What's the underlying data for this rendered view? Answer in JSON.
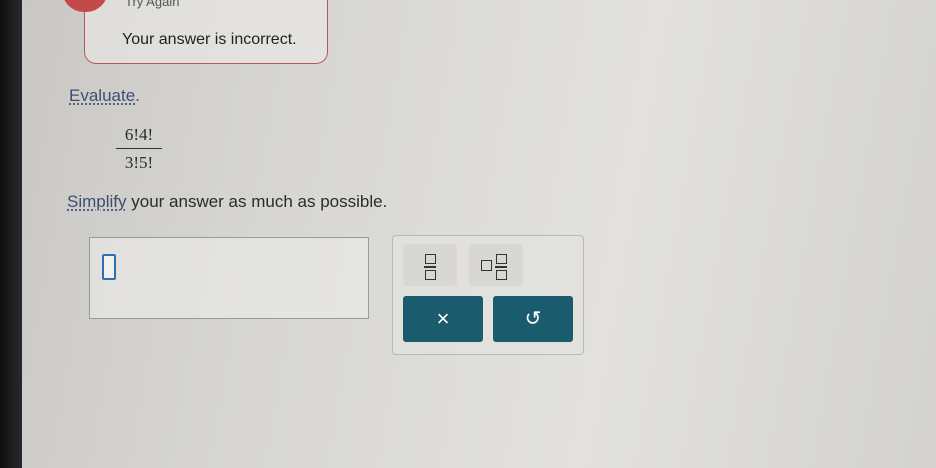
{
  "feedback": {
    "title": "Try Again",
    "message": "Your answer is incorrect."
  },
  "question": {
    "prompt_link": "Evaluate",
    "prompt_end": ".",
    "expression": {
      "numerator": "6!4!",
      "denominator": "3!5!"
    },
    "instruction_link": "Simplify",
    "instruction_rest": " your answer as much as possible."
  },
  "answer": {
    "value": ""
  },
  "keypad": {
    "clear_label": "×",
    "undo_label": "↺",
    "keys": [
      "fraction-icon",
      "mixed-number-icon"
    ]
  },
  "colors": {
    "feedback_accent": "#c44a4a",
    "link": "#3b4f73",
    "button": "#1a5b6e",
    "cursor": "#2c6fb3"
  }
}
